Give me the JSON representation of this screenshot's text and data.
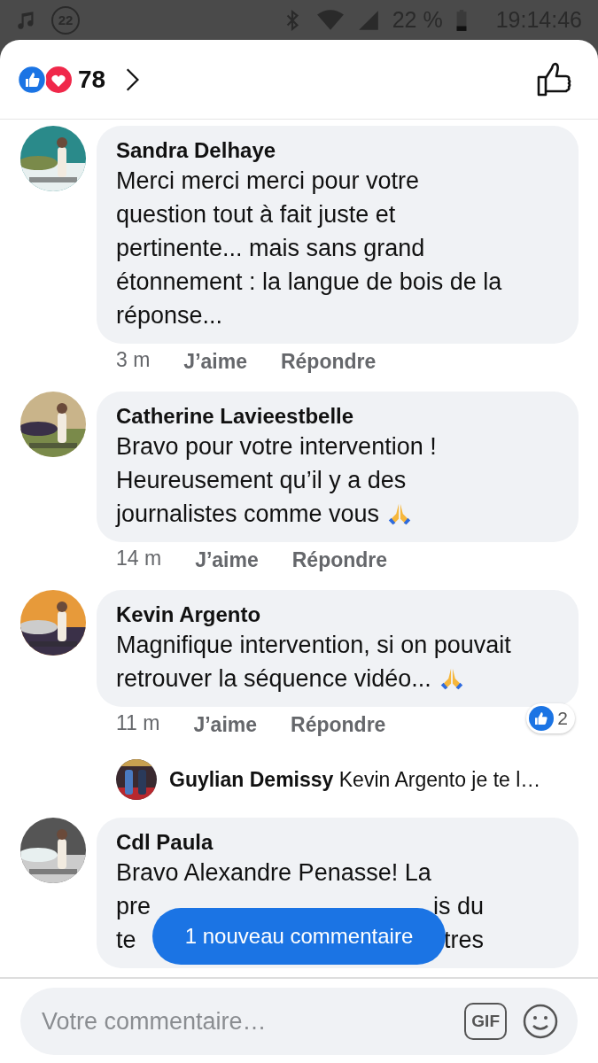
{
  "status_bar": {
    "notification_count": "22",
    "battery": "22 %",
    "time": "19:14:46"
  },
  "header": {
    "reaction_count": "78"
  },
  "comments": [
    {
      "author": "Sandra Delhaye",
      "lines": [
        {
          "kind": "full",
          "text": "Merci merci merci pour votre"
        },
        {
          "kind": "full",
          "text": "question tout à fait juste et"
        },
        {
          "kind": "full",
          "text": "pertinente... mais sans grand"
        },
        {
          "kind": "full",
          "text": "étonnement : la langue de bois de la"
        },
        {
          "kind": "full",
          "text": "réponse..."
        }
      ],
      "time": "3 m",
      "like": "J’aime",
      "reply": "Répondre"
    },
    {
      "author": "Catherine Lavieestbelle",
      "lines": [
        {
          "kind": "full",
          "text": "Bravo pour votre intervention !"
        },
        {
          "kind": "full",
          "text": "Heureusement qu’il y a des"
        },
        {
          "kind": "full",
          "text": "journalistes comme vous",
          "pray_emoji": true
        }
      ],
      "time": "14 m",
      "like": "J’aime",
      "reply": "Répondre"
    },
    {
      "author": "Kevin Argento",
      "lines": [
        {
          "kind": "full",
          "text": "Magnifique intervention, si on pouvait"
        },
        {
          "kind": "full",
          "text": "retrouver la séquence vidéo...",
          "pray_emoji": true
        }
      ],
      "time": "11 m",
      "like": "J’aime",
      "reply": "Répondre",
      "reaction_count": "2",
      "replies": [
        {
          "author": "Guylian Demissy",
          "text": "Kevin Argento je te l…"
        }
      ]
    },
    {
      "author": "Cdl Paula",
      "lines": [
        {
          "kind": "full",
          "text": "Bravo Alexandre Penasse! La"
        },
        {
          "kind": "covered",
          "left": "pre",
          "right": "is du"
        },
        {
          "kind": "covered",
          "left": "te",
          "right": "tres"
        }
      ]
    }
  ],
  "new_comments_button": "1 nouveau commentaire",
  "composer": {
    "placeholder": "Votre commentaire…",
    "gif_label": "GIF"
  }
}
